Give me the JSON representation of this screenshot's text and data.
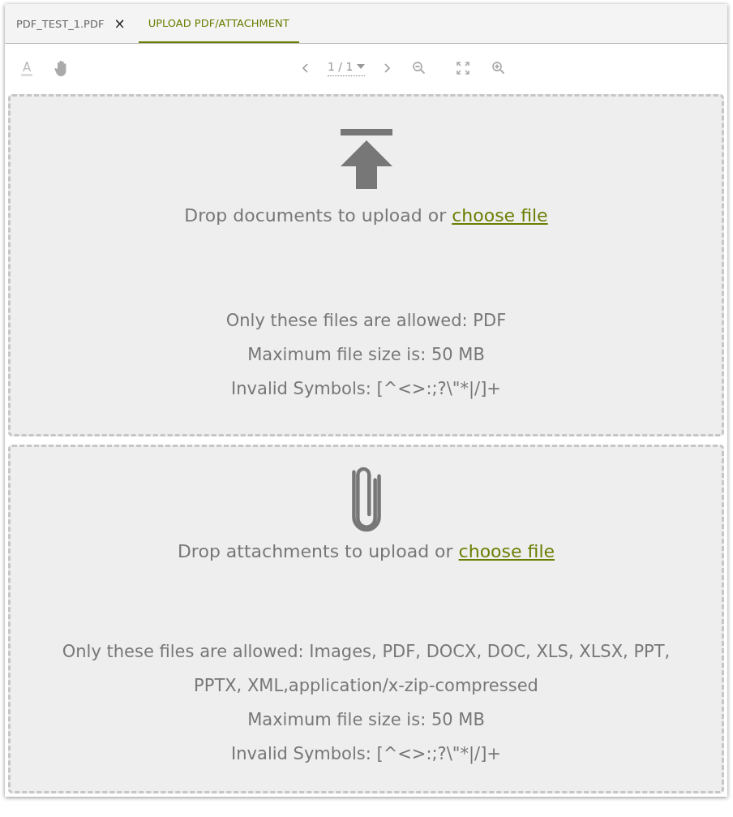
{
  "tabs": [
    {
      "label": "PDF_TEST_1.PDF",
      "selected": false,
      "close": "×"
    },
    {
      "label": "UPLOAD PDF/ATTACHMENT",
      "selected": true
    }
  ],
  "toolbar": {
    "text_tool": "A",
    "page": "1 / 1"
  },
  "drop_zones": [
    {
      "kind": "upload",
      "prompt": "Drop documents to upload or",
      "link": "choose file",
      "info": [
        "Only these files are allowed: PDF",
        "Maximum file size is: 50 MB",
        "Invalid Symbols: [^<>:;?\\\"*|/]+"
      ]
    },
    {
      "kind": "attachment",
      "prompt": "Drop attachments to upload or",
      "link": "choose file",
      "info": [
        "Only these files are allowed: Images, PDF, DOCX, DOC, XLS, XLSX, PPT, PPTX, XML,application/x-zip-compressed",
        "Maximum file size is: 50 MB",
        "Invalid Symbols: [^<>:;?\\\"*|/]+"
      ]
    }
  ]
}
